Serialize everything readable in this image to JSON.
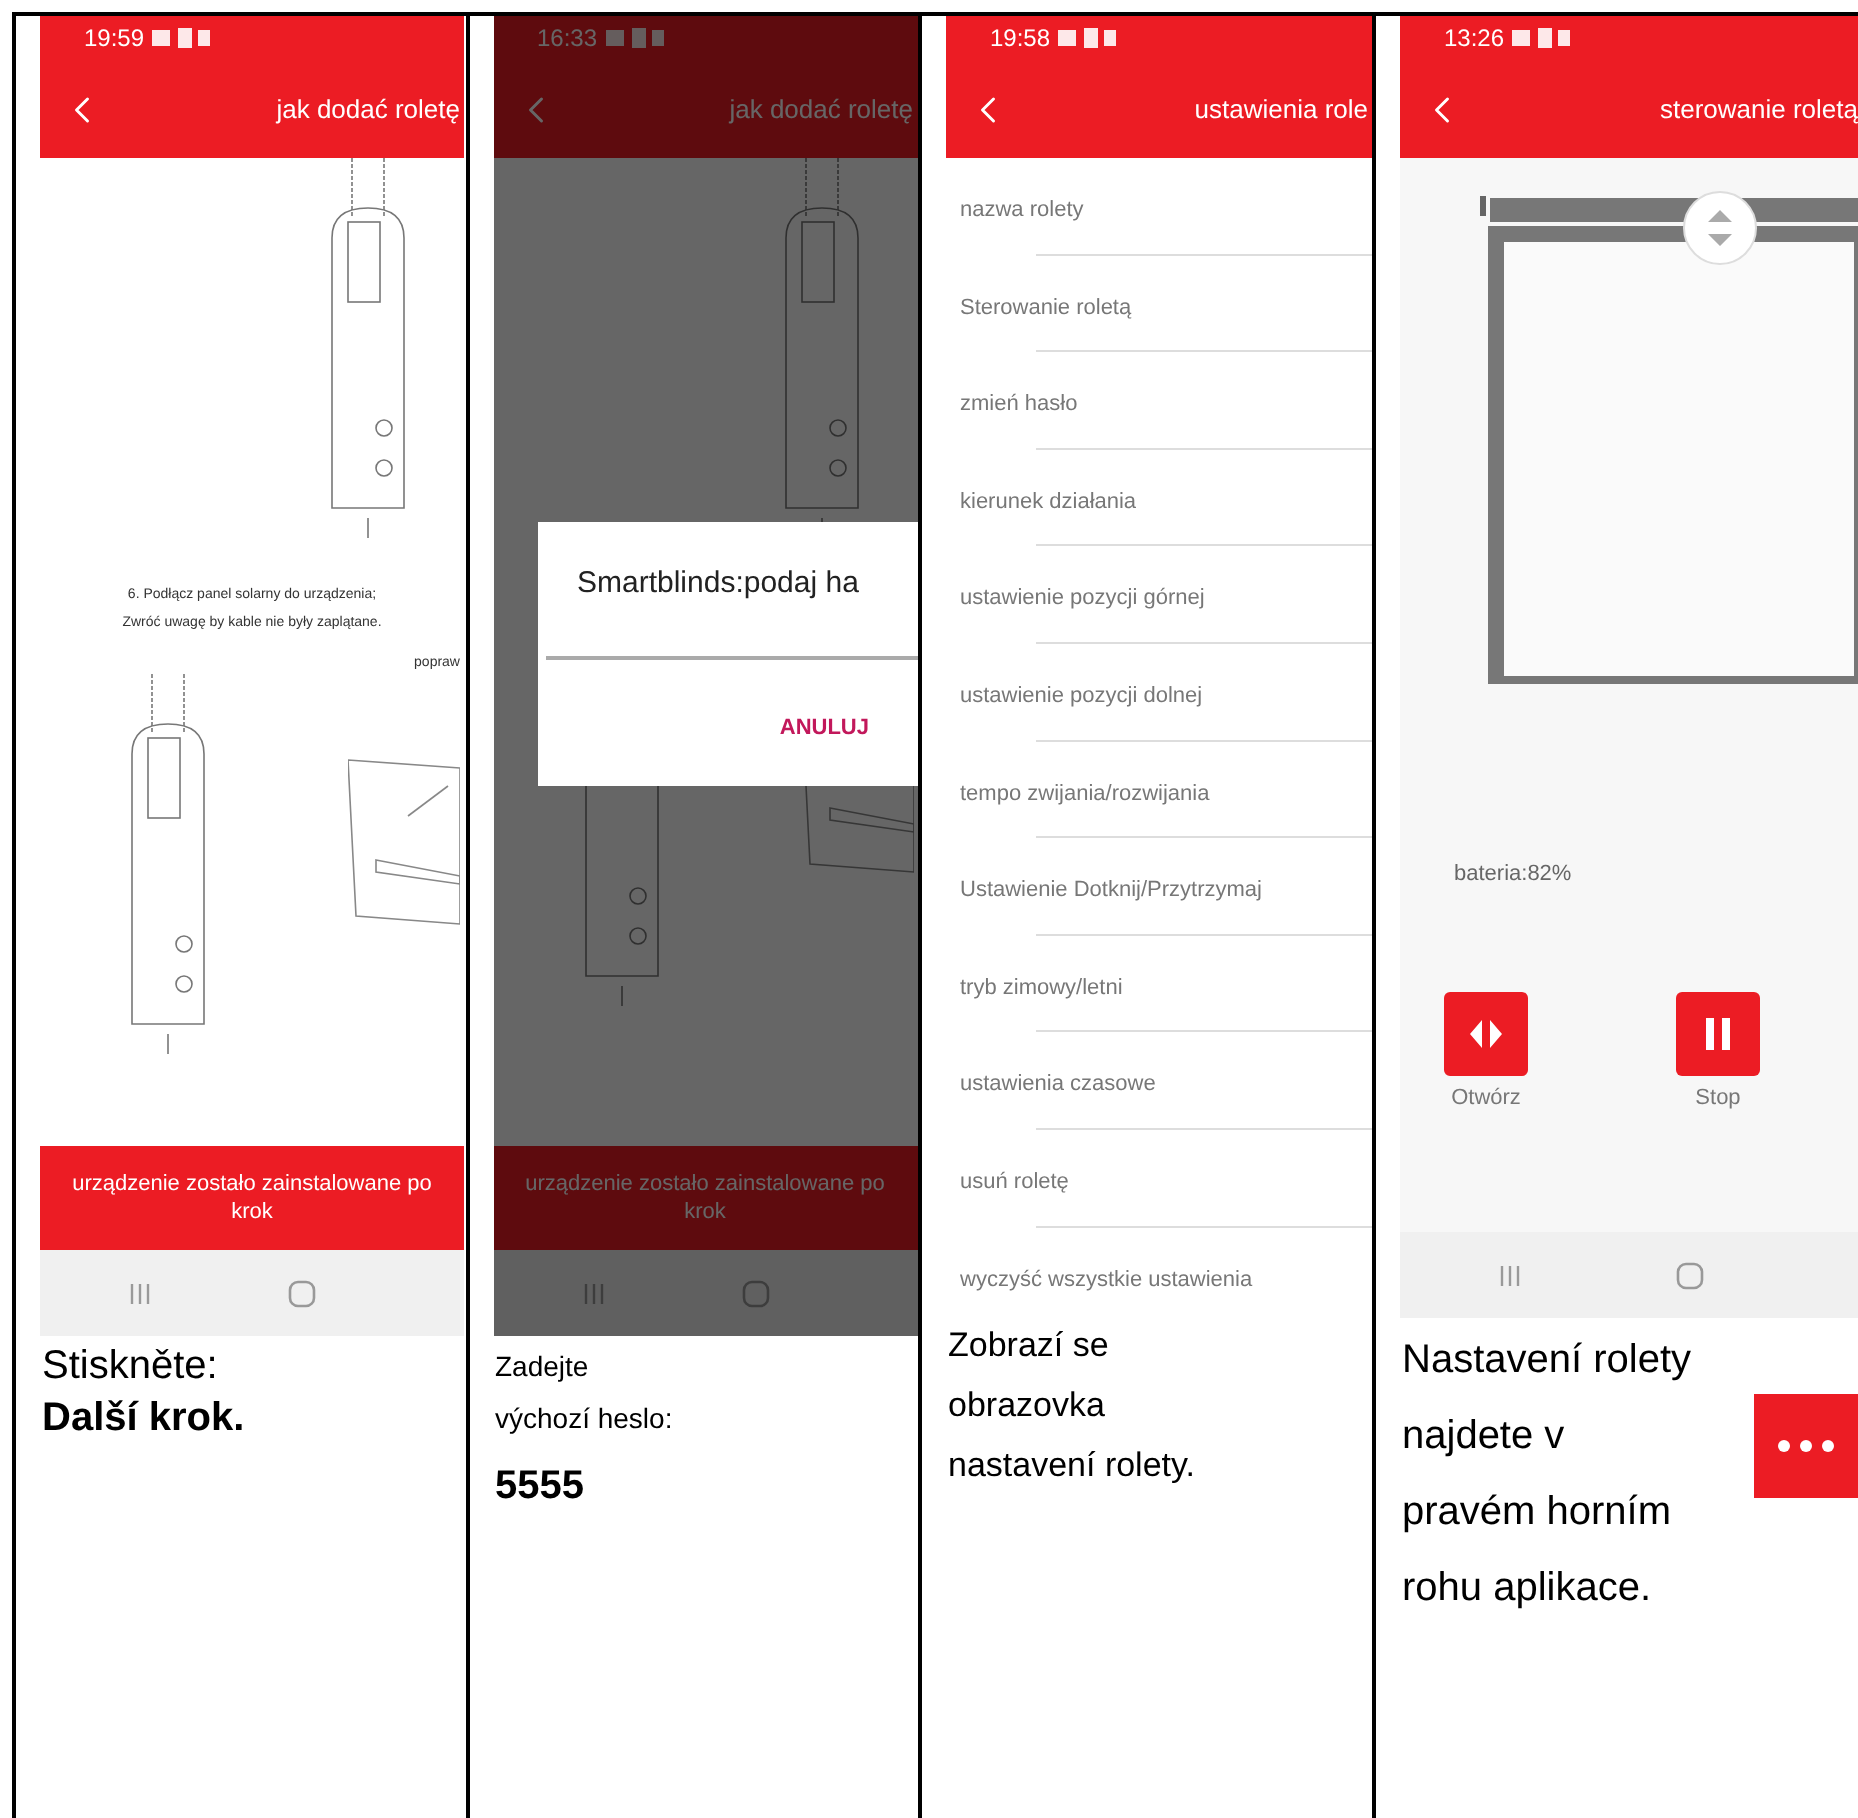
{
  "panels": [
    {
      "kind": "guide",
      "dimmed": false,
      "time": "19:59",
      "title": "jak dodać roletę",
      "instruction_lines": [
        "6. Podłącz panel solarny do urządzenia;",
        "Zwróć uwagę by kable nie były zaplątane."
      ],
      "side_label": "popraw",
      "button_lines": [
        "urządzenie zostało zainstalowane po",
        "krok"
      ],
      "caption": [
        {
          "kind": "step",
          "text": "Stiskněte:"
        },
        {
          "kind": "step_bold",
          "text": "Další krok."
        }
      ]
    },
    {
      "kind": "guide",
      "dimmed": true,
      "time": "16:33",
      "title": "jak dodać roletę",
      "button_lines": [
        "urządzenie zostało zainstalowane po",
        "krok"
      ],
      "dialog": {
        "title": "Smartblinds:podaj ha",
        "button": "ANULUJ"
      },
      "caption": [
        {
          "kind": "small",
          "text": "Zadejte\nvýchozí heslo:"
        },
        {
          "kind": "code",
          "text": "5555"
        }
      ]
    },
    {
      "kind": "settings",
      "time": "19:58",
      "title": "ustawienia role",
      "items": [
        "nazwa rolety",
        "Sterowanie roletą",
        "zmień hasło",
        "kierunek działania",
        "ustawienie pozycji górnej",
        "ustawienie pozycji dolnej",
        "tempo zwijania/rozwijania",
        "Ustawienie Dotknij/Przytrzymaj",
        "tryb zimowy/letni",
        "ustawienia czasowe",
        "usuń roletę",
        "wyczyść wszystkie ustawienia"
      ],
      "caption": [
        {
          "kind": "note",
          "text": "Zobrazí se\nobrazovka\nnastavení rolety."
        }
      ]
    },
    {
      "kind": "control",
      "time": "13:26",
      "title": "sterowanie roletą",
      "battery": "bateria:82%",
      "buttons": [
        {
          "kind": "open",
          "label": "Otwórz"
        },
        {
          "kind": "pause",
          "label": "Stop"
        }
      ],
      "caption": [
        {
          "kind": "tip",
          "text": "Nastavení rolety\nnajdete v\npravém horním\nrohu aplikace."
        }
      ],
      "more_button": true
    }
  ]
}
